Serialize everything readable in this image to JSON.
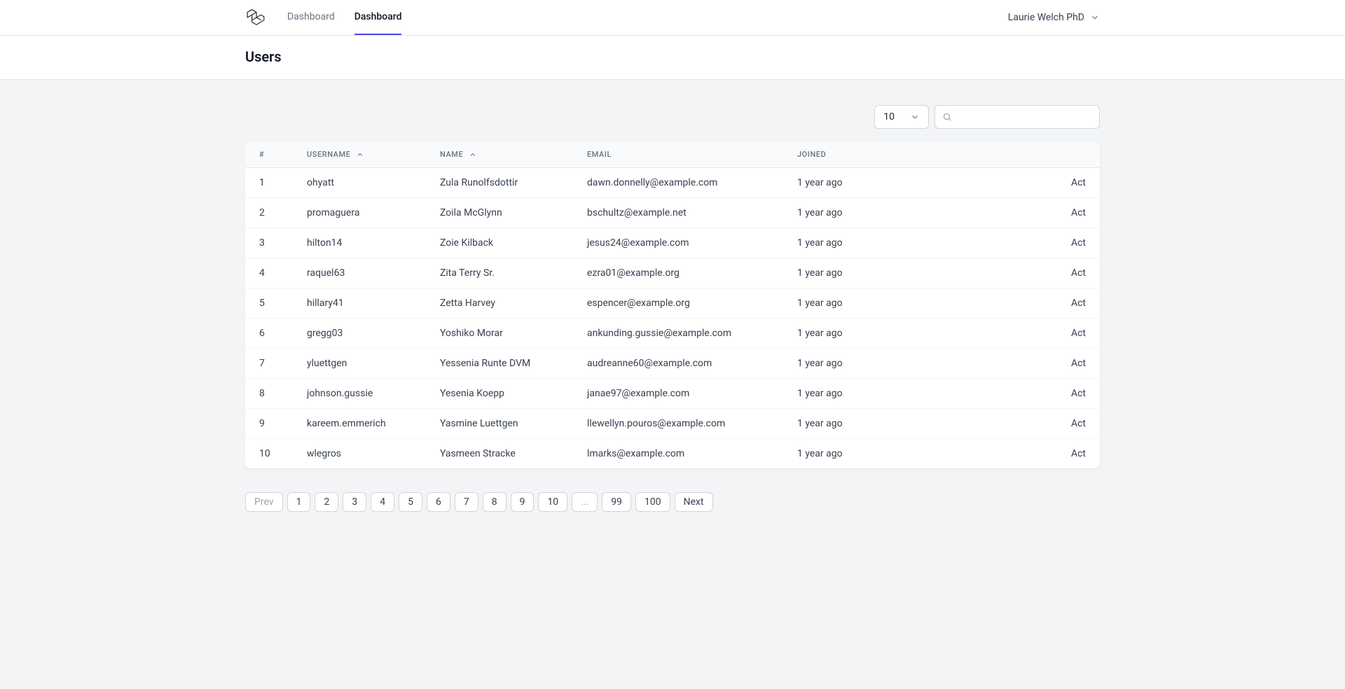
{
  "nav": {
    "tabs": [
      "Dashboard",
      "Dashboard"
    ],
    "active_index": 1
  },
  "user_menu": {
    "name": "Laurie Welch PhD"
  },
  "page": {
    "title": "Users"
  },
  "controls": {
    "page_size": "10",
    "search_value": ""
  },
  "table": {
    "headers": {
      "index": "#",
      "username": "USERNAME",
      "name": "NAME",
      "email": "EMAIL",
      "joined": "JOINED"
    },
    "action_label": "Act",
    "rows": [
      {
        "idx": "1",
        "username": "ohyatt",
        "name": "Zula Runolfsdottir",
        "email": "dawn.donnelly@example.com",
        "joined": "1 year ago"
      },
      {
        "idx": "2",
        "username": "promaguera",
        "name": "Zoila McGlynn",
        "email": "bschultz@example.net",
        "joined": "1 year ago"
      },
      {
        "idx": "3",
        "username": "hilton14",
        "name": "Zoie Kilback",
        "email": "jesus24@example.com",
        "joined": "1 year ago"
      },
      {
        "idx": "4",
        "username": "raquel63",
        "name": "Zita Terry Sr.",
        "email": "ezra01@example.org",
        "joined": "1 year ago"
      },
      {
        "idx": "5",
        "username": "hillary41",
        "name": "Zetta Harvey",
        "email": "espencer@example.org",
        "joined": "1 year ago"
      },
      {
        "idx": "6",
        "username": "gregg03",
        "name": "Yoshiko Morar",
        "email": "ankunding.gussie@example.com",
        "joined": "1 year ago"
      },
      {
        "idx": "7",
        "username": "yluettgen",
        "name": "Yessenia Runte DVM",
        "email": "audreanne60@example.com",
        "joined": "1 year ago"
      },
      {
        "idx": "8",
        "username": "johnson.gussie",
        "name": "Yesenia Koepp",
        "email": "janae97@example.com",
        "joined": "1 year ago"
      },
      {
        "idx": "9",
        "username": "kareem.emmerich",
        "name": "Yasmine Luettgen",
        "email": "llewellyn.pouros@example.com",
        "joined": "1 year ago"
      },
      {
        "idx": "10",
        "username": "wlegros",
        "name": "Yasmeen Stracke",
        "email": "lmarks@example.com",
        "joined": "1 year ago"
      }
    ]
  },
  "pagination": {
    "prev": "Prev",
    "next": "Next",
    "ellipsis": "...",
    "pages_left": [
      "1",
      "2",
      "3",
      "4",
      "5",
      "6",
      "7",
      "8",
      "9",
      "10"
    ],
    "pages_right": [
      "99",
      "100"
    ]
  }
}
